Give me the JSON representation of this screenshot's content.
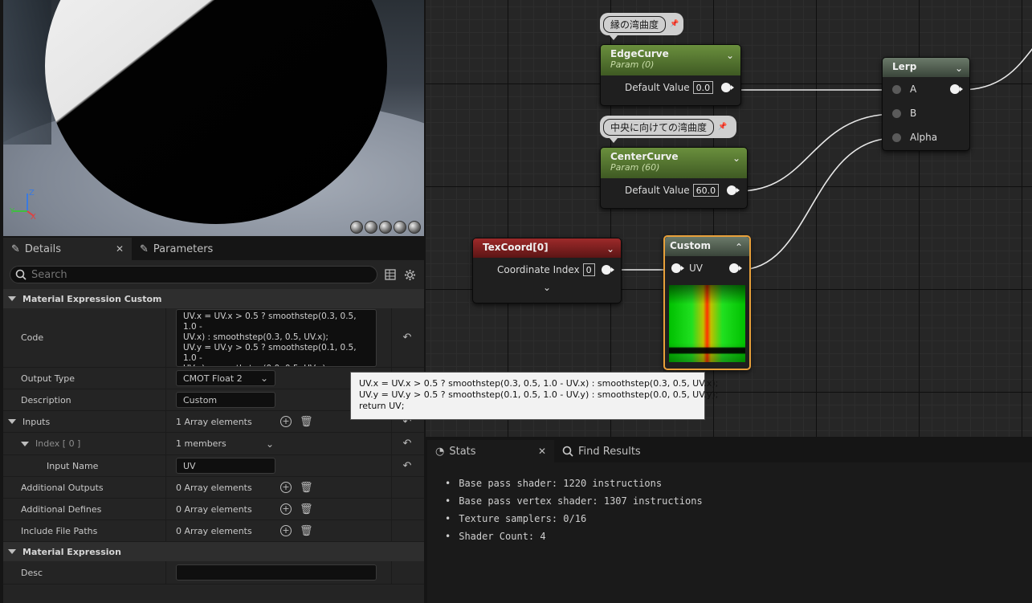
{
  "viewport": {
    "gizmo": {
      "x": "X",
      "y": "Y",
      "z": "Z"
    },
    "preview_buttons": [
      "sphere-preview",
      "sphere-alt-preview",
      "plane-preview",
      "cylinder-preview",
      "custom-mesh-preview"
    ]
  },
  "details": {
    "tabs": [
      {
        "label": "Details",
        "icon": "pencil-icon",
        "active": true
      },
      {
        "label": "Parameters",
        "icon": "pencil-icon",
        "active": false
      }
    ],
    "search_placeholder": "Search",
    "sections": {
      "custom": "Material Expression Custom",
      "expression": "Material Expression"
    },
    "props": {
      "code_label": "Code",
      "code_value": "UV.x = UV.x > 0.5 ? smoothstep(0.3, 0.5, 1.0 -\nUV.x) : smoothstep(0.3, 0.5, UV.x);\nUV.y = UV.y > 0.5 ? smoothstep(0.1, 0.5, 1.0 -\nUV.y) : smoothstep(0.0, 0.5, UV.y);\nreturn UV;",
      "output_type_label": "Output Type",
      "output_type_value": "CMOT Float 2",
      "description_label": "Description",
      "description_value": "Custom",
      "inputs_label": "Inputs",
      "inputs_value": "1 Array elements",
      "index_label": "Index [ 0 ]",
      "index_value": "1 members",
      "input_name_label": "Input Name",
      "input_name_value": "UV",
      "additional_outputs_label": "Additional Outputs",
      "additional_outputs_value": "0 Array elements",
      "additional_defines_label": "Additional Defines",
      "additional_defines_value": "0 Array elements",
      "include_paths_label": "Include File Paths",
      "include_paths_value": "0 Array elements",
      "desc_label": "Desc",
      "desc_value": ""
    }
  },
  "tooltip": "UV.x = UV.x > 0.5 ? smoothstep(0.3, 0.5, 1.0 - UV.x) : smoothstep(0.3, 0.5, UV.x);\nUV.y = UV.y > 0.5 ? smoothstep(0.1, 0.5, 1.0 - UV.y) : smoothstep(0.0, 0.5, UV.y);\nreturn UV;",
  "graph": {
    "comments": {
      "edge": "縁の湾曲度",
      "center": "中央に向けての湾曲度"
    },
    "edge_node": {
      "title": "EdgeCurve",
      "subtitle": "Param (0)",
      "pin_label": "Default Value",
      "value": "0.0"
    },
    "center_node": {
      "title": "CenterCurve",
      "subtitle": "Param (60)",
      "pin_label": "Default Value",
      "value": "60.0"
    },
    "lerp_node": {
      "title": "Lerp",
      "pins": [
        "A",
        "B",
        "Alpha"
      ]
    },
    "texcoord_node": {
      "title": "TexCoord[0]",
      "pin_label": "Coordinate Index",
      "value": "0"
    },
    "custom_node": {
      "title": "Custom",
      "pin_label": "UV"
    }
  },
  "stats": {
    "tabs": [
      {
        "label": "Stats",
        "icon": "stats-icon",
        "active": true
      },
      {
        "label": "Find Results",
        "icon": "search-icon",
        "active": false
      }
    ],
    "lines": [
      "Base pass shader: 1220 instructions",
      "Base pass vertex shader: 1307 instructions",
      "Texture samplers: 0/16",
      "Shader Count: 4"
    ]
  },
  "colors": {
    "param_header": "#5a7d32",
    "texcoord_header": "#8a2222",
    "selection": "#e8a03a"
  }
}
